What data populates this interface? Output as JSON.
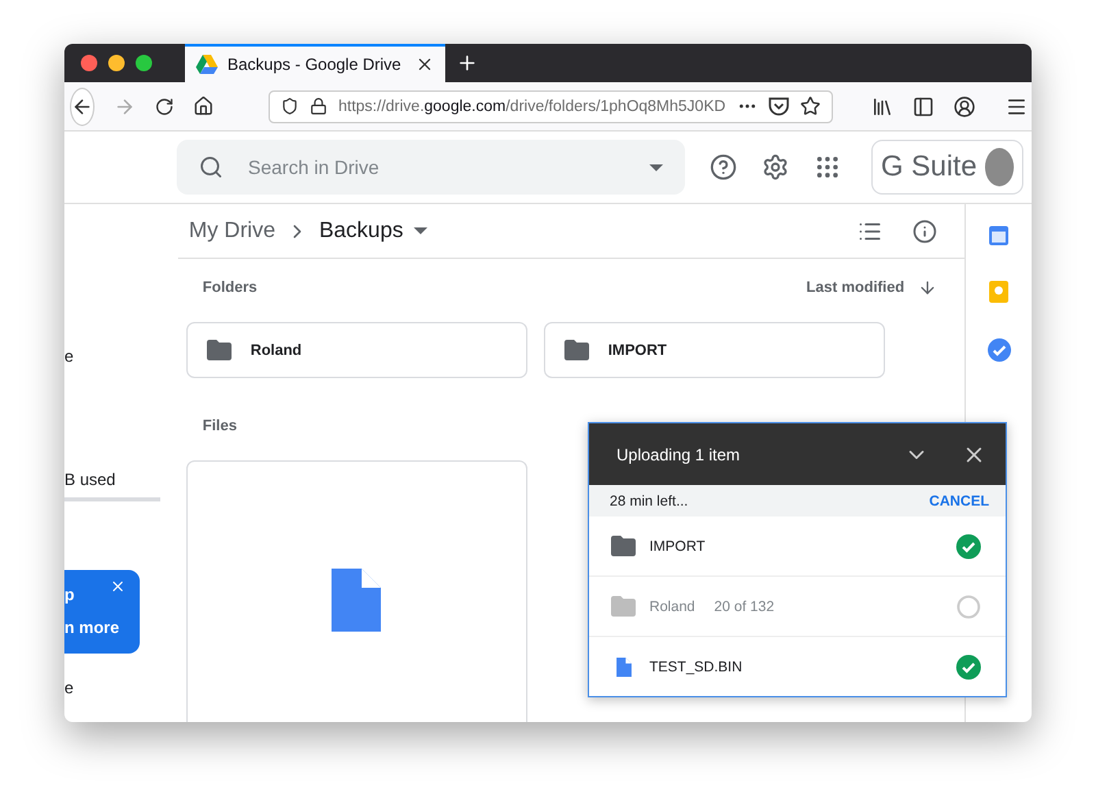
{
  "browser": {
    "tabs": [
      {
        "title": "Backups - Google Drive",
        "selected": true
      }
    ],
    "url": "https://drive.**google.com**/drive/folders/1phOq8Mh5J0KD"
  },
  "header": {
    "search_placeholder": "Search in Drive",
    "brand": "G Suite"
  },
  "sidebar": {
    "label_1": "e",
    "storage": "B used",
    "promo_lines": [
      "p",
      "n more"
    ],
    "label_2": "e"
  },
  "breadcrumb": [
    "My Drive",
    "Backups"
  ],
  "folders": {
    "label": "Folders",
    "sort": "Last modified",
    "items": [
      "Roland",
      "IMPORT"
    ]
  },
  "files": {
    "label": "Files",
    "items": [
      {
        "kind": "doc"
      }
    ]
  },
  "upload_panel": {
    "title": "Uploading 1 item",
    "time_left": "28 min left...",
    "action": "CANCEL",
    "items": [
      {
        "kind": "folder",
        "name": "IMPORT",
        "done": true
      },
      {
        "kind": "folder",
        "name": "Roland",
        "progress": "20 of 132",
        "done": false
      },
      {
        "kind": "file",
        "name": "TEST_SD.BIN",
        "done": true
      }
    ]
  }
}
